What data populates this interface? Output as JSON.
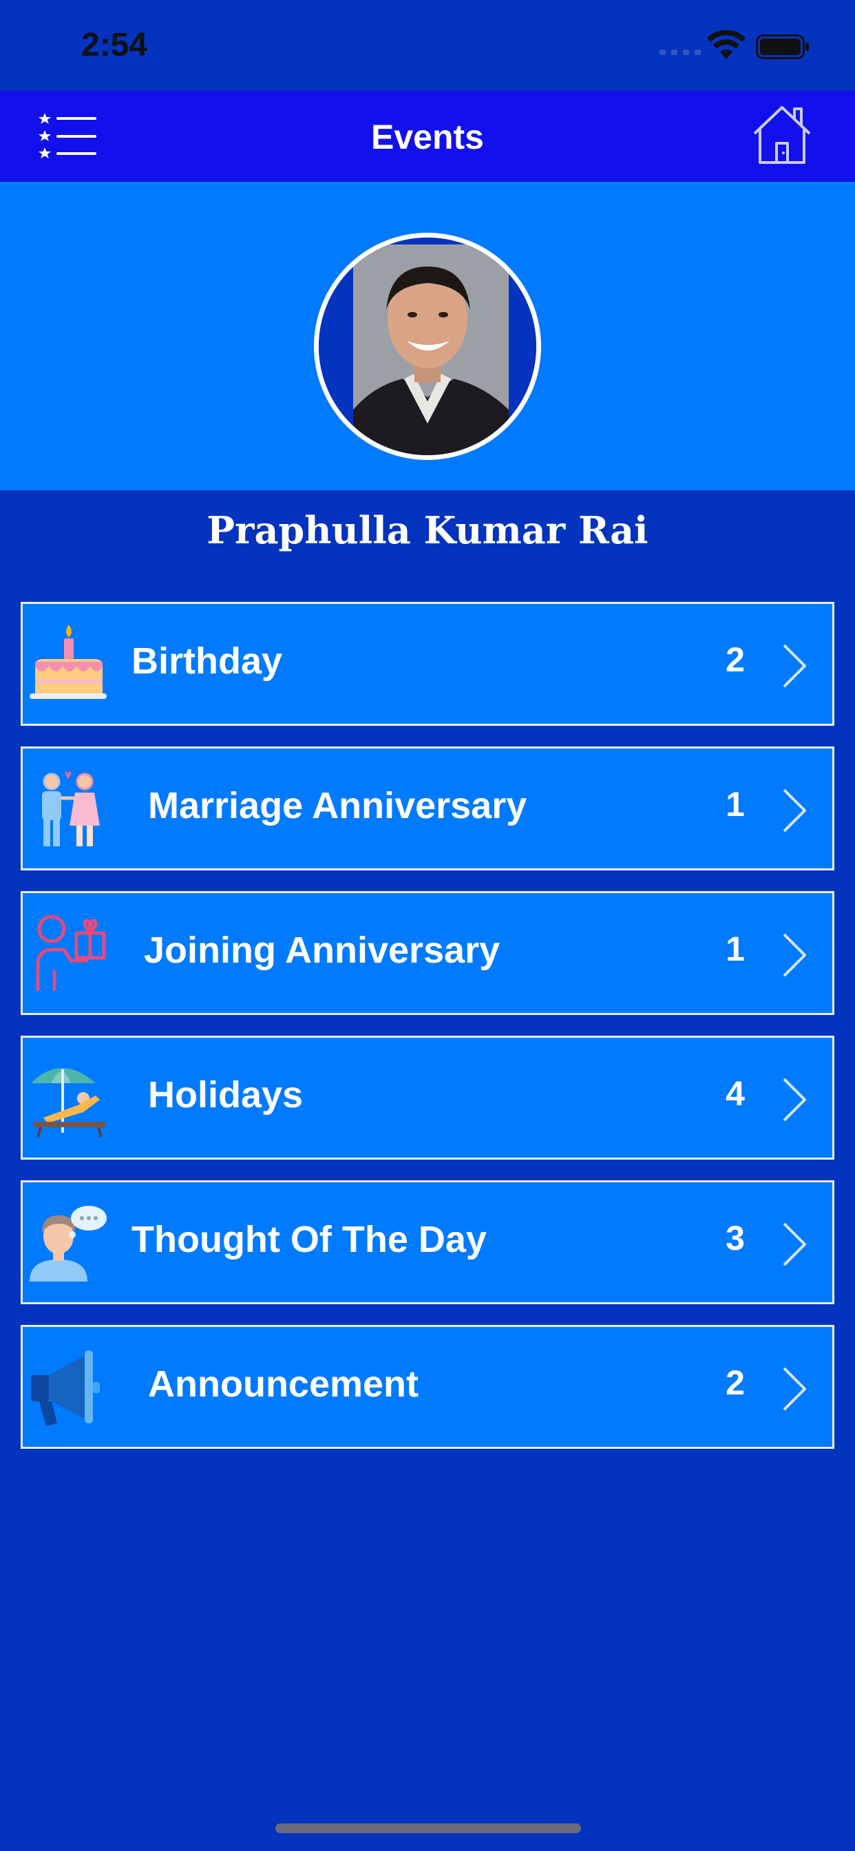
{
  "status_bar": {
    "time": "2:54"
  },
  "nav": {
    "title": "Events",
    "menu_icon": "star-list-icon",
    "home_icon": "home-icon"
  },
  "profile": {
    "name": "Praphulla Kumar Rai",
    "avatar_icon": "profile-photo"
  },
  "events": [
    {
      "label": "Birthday",
      "count": "2",
      "icon": "birthday-cake-icon"
    },
    {
      "label": "Marriage Anniversary",
      "count": "1",
      "icon": "couple-icon"
    },
    {
      "label": "Joining Anniversary",
      "count": "1",
      "icon": "person-gift-icon"
    },
    {
      "label": "Holidays",
      "count": "4",
      "icon": "beach-umbrella-icon"
    },
    {
      "label": "Thought Of The Day",
      "count": "3",
      "icon": "person-thought-icon"
    },
    {
      "label": "Announcement",
      "count": "2",
      "icon": "megaphone-icon"
    }
  ],
  "colors": {
    "background": "#0433BE",
    "nav_bar": "#1210EB",
    "header": "#007AFF",
    "row": "#007AFF",
    "row_border": "#E6ECFA",
    "text": "#FFFFFF"
  }
}
